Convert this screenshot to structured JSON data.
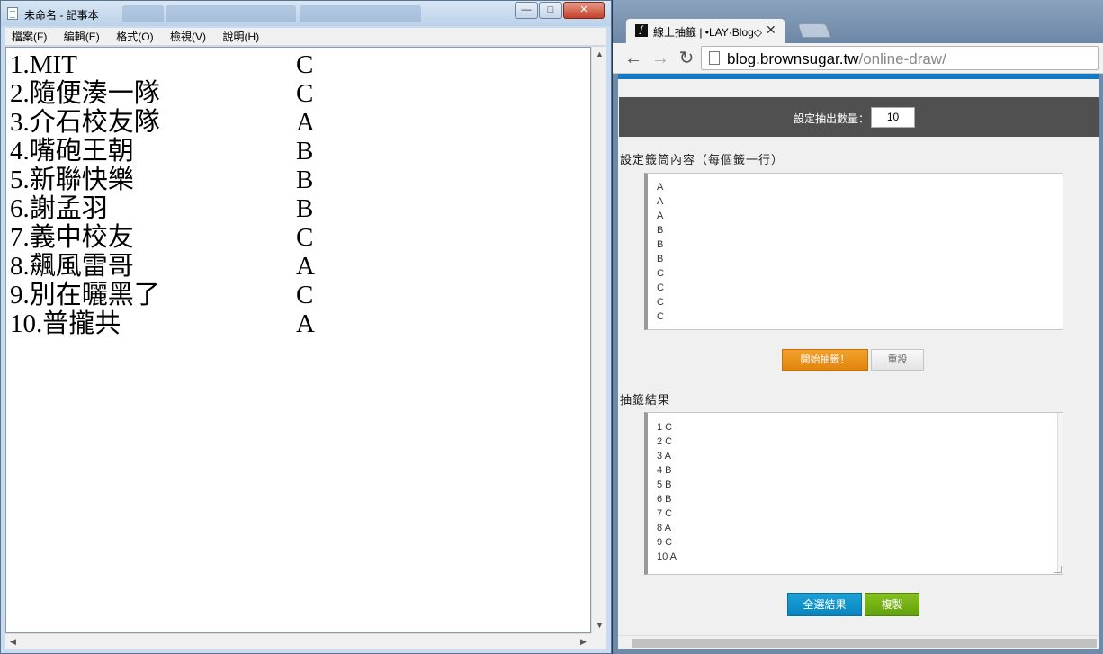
{
  "notepad": {
    "title": "未命名 - 記事本",
    "menu": [
      "檔案(F)",
      "編輯(E)",
      "格式(O)",
      "檢視(V)",
      "說明(H)"
    ],
    "lines": [
      {
        "name": "1.MIT",
        "group": "C"
      },
      {
        "name": "2.隨便湊一隊",
        "group": "C"
      },
      {
        "name": "3.介石校友隊",
        "group": "A"
      },
      {
        "name": "4.嘴砲王朝",
        "group": "B"
      },
      {
        "name": "5.新聯快樂",
        "group": "B"
      },
      {
        "name": "6.謝孟羽",
        "group": "B"
      },
      {
        "name": "7.義中校友",
        "group": "C"
      },
      {
        "name": "8.飆風雷哥",
        "group": "A"
      },
      {
        "name": "9.別在曬黑了",
        "group": "C"
      },
      {
        "name": "10.普攏共",
        "group": "A"
      }
    ],
    "buttons": {
      "minimize": "—",
      "maximize": "□",
      "close": "✕"
    }
  },
  "browser": {
    "tab_title": "線上抽籤 | •LAY·Blog◇",
    "tab_close": "✕",
    "url_host": "blog.brownsugar.tw",
    "url_path": "/online-draw/",
    "nav": {
      "back": "←",
      "forward": "→",
      "reload": "↻"
    }
  },
  "page": {
    "count_label": "設定抽出數量：",
    "count_value": "10",
    "content_label": "設定籤筒內容（每個籤一行）",
    "content_lines": [
      "A",
      "A",
      "A",
      "B",
      "B",
      "B",
      "C",
      "C",
      "C",
      "C"
    ],
    "start_button": "開始抽籤！",
    "reset_button": "重設",
    "result_label": "抽籤結果",
    "result_lines": [
      "1 C",
      "2 C",
      "3 A",
      "4 B",
      "5 B",
      "6 B",
      "7 C",
      "8 A",
      "9 C",
      "10 A"
    ],
    "select_all_button": "全選結果",
    "copy_button": "複製"
  },
  "colors": {
    "accent_blue": "#1277c5",
    "start_orange": "#e98f0e",
    "select_blue": "#0b94cc",
    "copy_green": "#6aaa0f",
    "bar_dark": "#505050"
  }
}
